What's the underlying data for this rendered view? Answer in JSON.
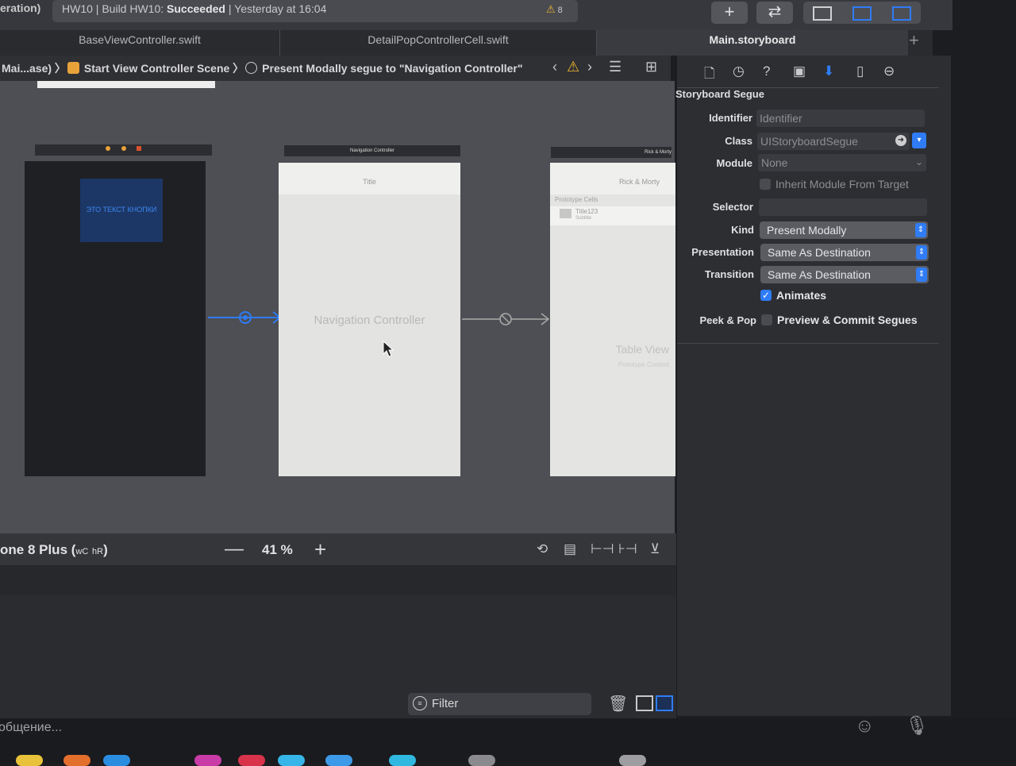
{
  "toolbar": {
    "scheme_fragment": "eration)",
    "activity_project": "HW10",
    "activity_build": "Build HW10:",
    "activity_status": "Succeeded",
    "activity_time": "Yesterday at 16:04",
    "warning_count": "8",
    "icons": [
      "plus-icon",
      "swap-icon",
      "left-panel-icon",
      "bottom-panel-icon",
      "right-panel-icon"
    ]
  },
  "tabs": [
    {
      "label": "BaseViewController.swift"
    },
    {
      "label": "DetailPopControllerCell.swift"
    },
    {
      "label": "Main.storyboard",
      "active": true
    }
  ],
  "jumpbar": {
    "crumb1": "Mai...ase)",
    "crumb2": "Start View Controller Scene",
    "crumb3": "Present Modally segue to \"Navigation Controller\""
  },
  "canvas": {
    "scene1": {
      "button_text": "ЭТО ТЕКСТ КНОПКИ"
    },
    "scene2": {
      "header": "Navigation Controller",
      "nav_title": "Title",
      "label": "Navigation Controller"
    },
    "scene3": {
      "header": "Rick & Morty",
      "nav_title": "Rick & Morty",
      "section": "Prototype Cells",
      "cell_title": "Title123",
      "cell_subtitle": "Subtitle",
      "label": "Table View",
      "sublabel": "Prototype Content"
    }
  },
  "canvas_bar": {
    "device": "one 8 Plus",
    "size_class_w": "wC",
    "size_class_h": "hR",
    "zoom": "41 %"
  },
  "debug": {
    "filter_placeholder": "Filter"
  },
  "inspector": {
    "title": "Storyboard Segue",
    "identifier_label": "Identifier",
    "identifier_placeholder": "Identifier",
    "class_label": "Class",
    "class_value": "UIStoryboardSegue",
    "module_label": "Module",
    "module_value": "None",
    "inherit_label": "Inherit Module From Target",
    "selector_label": "Selector",
    "kind_label": "Kind",
    "kind_value": "Present Modally",
    "presentation_label": "Presentation",
    "presentation_value": "Same As Destination",
    "transition_label": "Transition",
    "transition_value": "Same As Destination",
    "animates_label": "Animates",
    "animates_checked": true,
    "peek_label": "Peek & Pop",
    "peek_option": "Preview & Commit Segues",
    "peek_checked": false
  },
  "message_bar": {
    "placeholder": "общение..."
  },
  "colors": {
    "accent": "#2f7cf6",
    "warning": "#f1b72d"
  }
}
